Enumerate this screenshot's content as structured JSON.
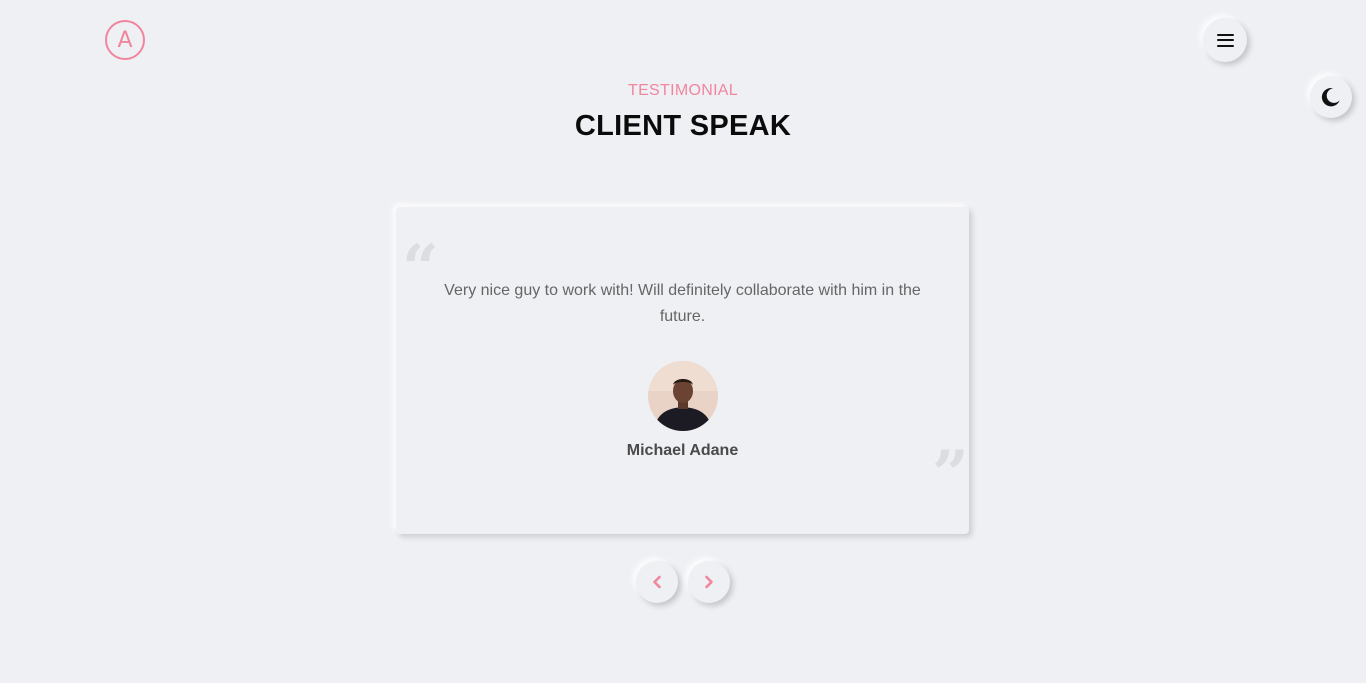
{
  "header": {
    "logo_letter": "A",
    "menu_icon": "hamburger-icon",
    "theme_icon": "moon-icon"
  },
  "section": {
    "subtitle": "TESTIMONIAL",
    "title": "CLIENT SPEAK"
  },
  "testimonial": {
    "text": "Very nice guy to work with! Will definitely collaborate with him in the future.",
    "author": "Michael Adane",
    "open_quote": "“",
    "close_quote": "”"
  },
  "carousel": {
    "prev_icon": "chevron-left-icon",
    "next_icon": "chevron-right-icon"
  },
  "colors": {
    "accent": "#f0859e",
    "background": "#eff0f4",
    "title": "#0b0b0b",
    "body_text": "#666666"
  }
}
